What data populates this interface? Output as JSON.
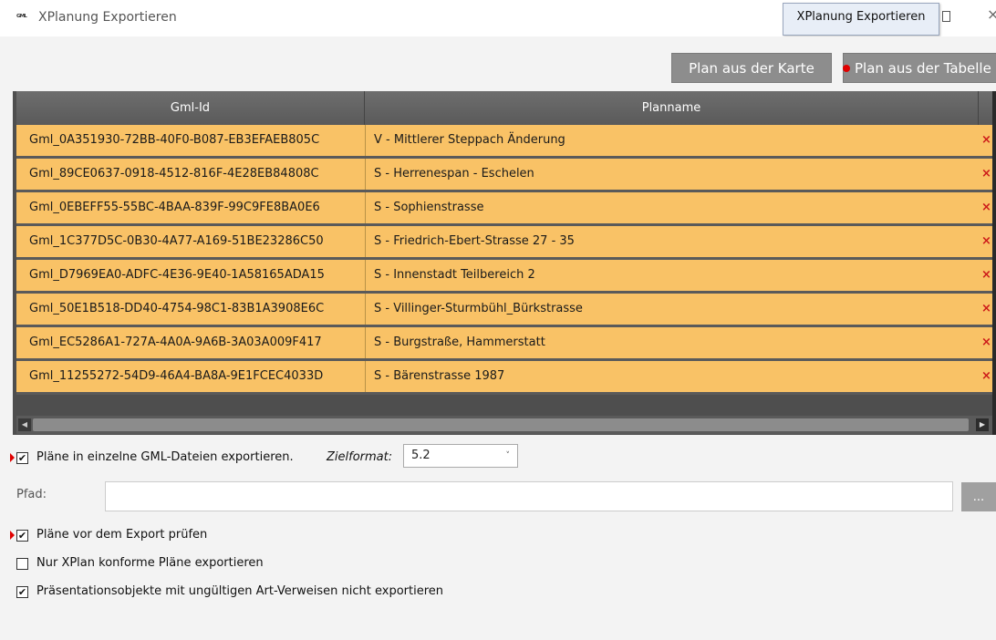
{
  "window": {
    "title": "XPlanung Exportieren",
    "icon_text": "ᴳᴹᴸ",
    "tooltip": "XPlanung Exportieren",
    "close_glyph": "×"
  },
  "toolbar": {
    "plan_from_map": "Plan aus der Karte",
    "plan_from_table": "Plan aus der Tabelle"
  },
  "table": {
    "columns": [
      "Gml-Id",
      "Planname"
    ],
    "remove_glyph": "×",
    "rows": [
      {
        "gml_id": "Gml_0A351930-72BB-40F0-B087-EB3EFAEB805C",
        "planname": "V - Mittlerer Steppach Änderung"
      },
      {
        "gml_id": "Gml_89CE0637-0918-4512-816F-4E28EB84808C",
        "planname": "S - Herrenespan - Eschelen"
      },
      {
        "gml_id": "Gml_0EBEFF55-55BC-4BAA-839F-99C9FE8BA0E6",
        "planname": "S - Sophienstrasse"
      },
      {
        "gml_id": "Gml_1C377D5C-0B30-4A77-A169-51BE23286C50",
        "planname": "S - Friedrich-Ebert-Strasse 27 - 35"
      },
      {
        "gml_id": "Gml_D7969EA0-ADFC-4E36-9E40-1A58165ADA15",
        "planname": "S - Innenstadt Teilbereich 2"
      },
      {
        "gml_id": "Gml_50E1B518-DD40-4754-98C1-83B1A3908E6C",
        "planname": "S - Villinger-Sturmbühl_Bürkstrasse"
      },
      {
        "gml_id": "Gml_EC5286A1-727A-4A0A-9A6B-3A03A009F417",
        "planname": "S - Burgstraße, Hammerstatt"
      },
      {
        "gml_id": "Gml_11255272-54D9-46A4-BA8A-9E1FCEC4033D",
        "planname": "S - Bärenstrasse 1987"
      }
    ]
  },
  "options": {
    "export_single_files": {
      "label": "Pläne in einzelne GML-Dateien exportieren.",
      "checked": true
    },
    "zielformat_label": "Zielformat:",
    "zielformat_value": "5.2",
    "pfad_label": "Pfad:",
    "browse_label": "...",
    "validate_before_export": {
      "label": "Pläne vor dem Export prüfen",
      "checked": true
    },
    "only_conform": {
      "label": "Nur XPlan konforme Pläne exportieren",
      "checked": false
    },
    "skip_invalid_presentation": {
      "label": "Präsentationsobjekte mit ungültigen Art-Verweisen nicht exportieren",
      "checked": true
    }
  },
  "colors": {
    "row_bg": "#f9c266",
    "header_bg": "#5e5e5e",
    "button_bg": "#8d8d8d",
    "remove_x": "#cc1a1a"
  }
}
